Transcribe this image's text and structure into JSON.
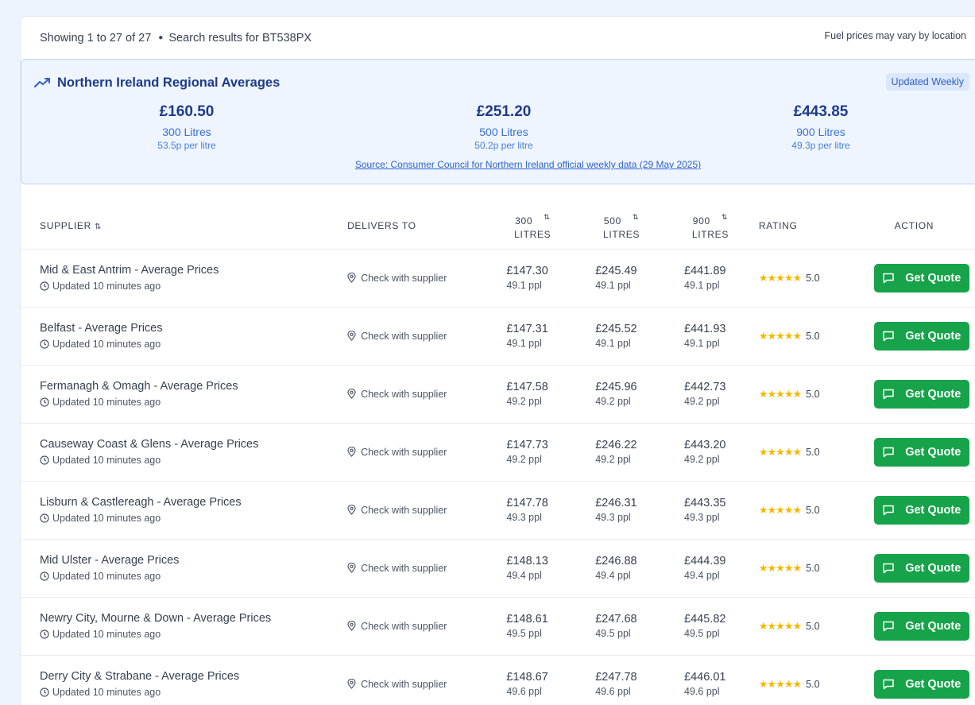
{
  "header": {
    "showing": "Showing 1 to 27 of 27",
    "search": "Search results for BT538PX",
    "note": "Fuel prices may vary by location"
  },
  "averages": {
    "title": "Northern Ireland Regional Averages",
    "badge": "Updated Weekly",
    "items": [
      {
        "price": "£160.50",
        "volume": "300 Litres",
        "ppl": "53.5p per litre"
      },
      {
        "price": "£251.20",
        "volume": "500 Litres",
        "ppl": "50.2p per litre"
      },
      {
        "price": "£443.85",
        "volume": "900 Litres",
        "ppl": "49.3p per litre"
      }
    ],
    "source": "Source: Consumer Council for Northern Ireland official weekly data (29 May 2025)"
  },
  "table": {
    "headers": {
      "supplier": "SUPPLIER",
      "delivers": "DELIVERS TO",
      "v300a": "300",
      "v300b": "LITRES",
      "v500a": "500",
      "v500b": "LITRES",
      "v900a": "900",
      "v900b": "LITRES",
      "rating": "RATING",
      "action": "ACTION"
    },
    "rows": [
      {
        "name": "Mid & East Antrim - Average Prices",
        "updated": "Updated 10 minutes ago",
        "delivers": "Check with supplier",
        "p300": "£147.30",
        "ppl300": "49.1 ppl",
        "p500": "£245.49",
        "ppl500": "49.1 ppl",
        "p900": "£441.89",
        "ppl900": "49.1 ppl",
        "stars": "★★★★★",
        "rating": "5.0",
        "action": "Get Quote"
      },
      {
        "name": "Belfast - Average Prices",
        "updated": "Updated 10 minutes ago",
        "delivers": "Check with supplier",
        "p300": "£147.31",
        "ppl300": "49.1 ppl",
        "p500": "£245.52",
        "ppl500": "49.1 ppl",
        "p900": "£441.93",
        "ppl900": "49.1 ppl",
        "stars": "★★★★★",
        "rating": "5.0",
        "action": "Get Quote"
      },
      {
        "name": "Fermanagh & Omagh - Average Prices",
        "updated": "Updated 10 minutes ago",
        "delivers": "Check with supplier",
        "p300": "£147.58",
        "ppl300": "49.2 ppl",
        "p500": "£245.96",
        "ppl500": "49.2 ppl",
        "p900": "£442.73",
        "ppl900": "49.2 ppl",
        "stars": "★★★★★",
        "rating": "5.0",
        "action": "Get Quote"
      },
      {
        "name": "Causeway Coast & Glens - Average Prices",
        "updated": "Updated 10 minutes ago",
        "delivers": "Check with supplier",
        "p300": "£147.73",
        "ppl300": "49.2 ppl",
        "p500": "£246.22",
        "ppl500": "49.2 ppl",
        "p900": "£443.20",
        "ppl900": "49.2 ppl",
        "stars": "★★★★★",
        "rating": "5.0",
        "action": "Get Quote"
      },
      {
        "name": "Lisburn & Castlereagh - Average Prices",
        "updated": "Updated 10 minutes ago",
        "delivers": "Check with supplier",
        "p300": "£147.78",
        "ppl300": "49.3 ppl",
        "p500": "£246.31",
        "ppl500": "49.3 ppl",
        "p900": "£443.35",
        "ppl900": "49.3 ppl",
        "stars": "★★★★★",
        "rating": "5.0",
        "action": "Get Quote"
      },
      {
        "name": "Mid Ulster - Average Prices",
        "updated": "Updated 10 minutes ago",
        "delivers": "Check with supplier",
        "p300": "£148.13",
        "ppl300": "49.4 ppl",
        "p500": "£246.88",
        "ppl500": "49.4 ppl",
        "p900": "£444.39",
        "ppl900": "49.4 ppl",
        "stars": "★★★★★",
        "rating": "5.0",
        "action": "Get Quote"
      },
      {
        "name": "Newry City, Mourne & Down - Average Prices",
        "updated": "Updated 10 minutes ago",
        "delivers": "Check with supplier",
        "p300": "£148.61",
        "ppl300": "49.5 ppl",
        "p500": "£247.68",
        "ppl500": "49.5 ppl",
        "p900": "£445.82",
        "ppl900": "49.5 ppl",
        "stars": "★★★★★",
        "rating": "5.0",
        "action": "Get Quote"
      },
      {
        "name": "Derry City & Strabane - Average Prices",
        "updated": "Updated 10 minutes ago",
        "delivers": "Check with supplier",
        "p300": "£148.67",
        "ppl300": "49.6 ppl",
        "p500": "£247.78",
        "ppl500": "49.6 ppl",
        "p900": "£446.01",
        "ppl900": "49.6 ppl",
        "stars": "★★★★★",
        "rating": "5.0",
        "action": "Get Quote"
      }
    ]
  },
  "icons": {
    "trend": "trending-up-icon",
    "clock": "clock-icon",
    "pin": "map-pin-icon",
    "chat": "message-square-icon",
    "sort": "sort-icon",
    "star": "star-icon"
  },
  "colors": {
    "accent": "#1e3a8a",
    "button": "#16a34a",
    "stars": "#f5b800",
    "panel": "#eef5ff"
  }
}
